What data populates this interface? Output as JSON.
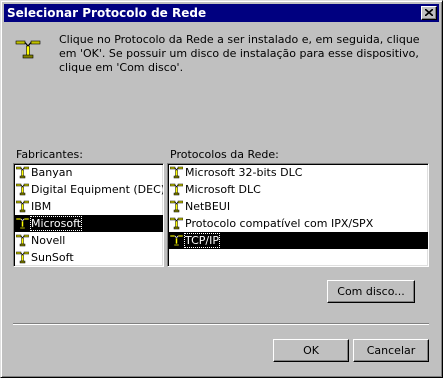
{
  "dialog": {
    "title": "Selecionar Protocolo de Rede",
    "intro": "Clique no Protocolo da Rede a ser instalado e, em seguida, clique em 'OK'. Se possuir um disco de instalação para esse dispositivo, clique em 'Com disco'."
  },
  "manufacturers": {
    "label": "Fabricantes:",
    "items": [
      {
        "label": "Banyan"
      },
      {
        "label": "Digital Equipment (DEC)"
      },
      {
        "label": "IBM"
      },
      {
        "label": "Microsoft"
      },
      {
        "label": "Novell"
      },
      {
        "label": "SunSoft"
      }
    ],
    "selected": "Microsoft"
  },
  "protocols": {
    "label": "Protocolos da Rede:",
    "items": [
      {
        "label": "Microsoft 32-bits DLC"
      },
      {
        "label": "Microsoft DLC"
      },
      {
        "label": "NetBEUI"
      },
      {
        "label": "Protocolo compatível com IPX/SPX"
      },
      {
        "label": "TCP/IP"
      }
    ],
    "selected": "TCP/IP"
  },
  "buttons": {
    "have_disk": "Com disco...",
    "ok": "OK",
    "cancel": "Cancelar"
  },
  "colors": {
    "titlebar": "#000080",
    "dialog_face": "#c0c0c0",
    "selection": "#000000"
  },
  "icons": {
    "item": "network-protocol-icon",
    "header": "network-protocol-icon",
    "close": "close-icon"
  }
}
